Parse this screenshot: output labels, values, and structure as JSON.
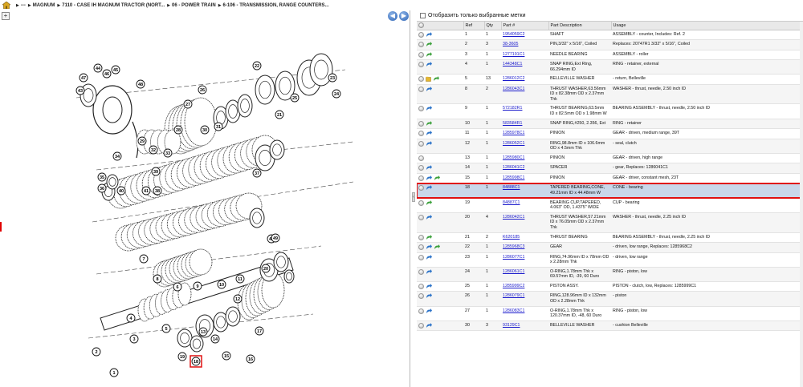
{
  "breadcrumb": {
    "items": [
      "---",
      "MAGNUM",
      "7110 - CASE IH MAGNUM TRACTOR (NORT...",
      "06 - POWER TRAIN",
      "6-106 - TRANSMISSION, RANGE COUNTERS..."
    ]
  },
  "diagram": {
    "zoom_label": "+",
    "prev_label": "◀",
    "next_label": "▶",
    "callouts": [
      "1",
      "2",
      "3",
      "4",
      "5",
      "6",
      "7",
      "8",
      "9",
      "10",
      "11",
      "12",
      "13",
      "14",
      "15",
      "16",
      "17",
      "18",
      "19",
      "20",
      "21",
      "22",
      "23",
      "24",
      "25",
      "26",
      "27",
      "28",
      "29",
      "30",
      "31",
      "32",
      "33",
      "34",
      "35",
      "36",
      "37",
      "38",
      "39",
      "40",
      "41",
      "42",
      "43",
      "44",
      "45",
      "46",
      "47",
      "48",
      "49"
    ],
    "highlighted_callout": "18"
  },
  "filter": {
    "label": "Отобразить только выбранные метки",
    "checked": false
  },
  "table": {
    "columns": [
      "",
      "Ref",
      "Qty",
      "Part #",
      "Part Description",
      "Usage"
    ],
    "rows": [
      {
        "icons": [
          "info",
          "arrow-blue"
        ],
        "ref": "1",
        "qty": "1",
        "part": "1954059C2",
        "desc": "SHAFT",
        "usage": "ASSEMBLY - counter, Includes: Ref. 2"
      },
      {
        "icons": [
          "info",
          "arrow-green"
        ],
        "ref": "2",
        "qty": "3",
        "part": "38-3605",
        "desc": "PIN,3/32\" x 5/16\", Coiled",
        "usage": "Replaces: 20747R1 3/32\" x 5/16\", Coiled"
      },
      {
        "icons": [
          "info",
          "arrow-green"
        ],
        "ref": "3",
        "qty": "1",
        "part": "1277191C1",
        "desc": "NEEDLE BEARING",
        "usage": "ASSEMBLY - roller"
      },
      {
        "icons": [
          "info",
          "arrow-blue"
        ],
        "ref": "4",
        "qty": "1",
        "part": "144348C1",
        "desc": "SNAP RING,Ext Rtng, 66.294mm ID",
        "usage": "RING - retainer, external"
      },
      {
        "icons": [
          "info",
          "cart",
          "arrow-green"
        ],
        "ref": "5",
        "qty": "13",
        "part": "1286012C2",
        "desc": "BELLEVILLE WASHER",
        "usage": "- return, Belleville"
      },
      {
        "icons": [
          "info",
          "arrow-blue"
        ],
        "ref": "8",
        "qty": "2",
        "part": "1286043C1",
        "desc": "THRUST WASHER,63.56mm ID x 82.38mm OD x 2.37mm Thk",
        "usage": "WASHER - thrust, needle, 2.50 inch ID"
      },
      {
        "icons": [
          "info",
          "arrow-blue"
        ],
        "ref": "9",
        "qty": "1",
        "part": "572182R1",
        "desc": "THRUST BEARING,63.5mm ID x 82.5mm OD x 1.98mm W",
        "usage": "BEARING ASSEMBLY - thrust, needle, 2.50 inch ID"
      },
      {
        "icons": [
          "info",
          "arrow-green"
        ],
        "ref": "10",
        "qty": "1",
        "part": "583584R1",
        "desc": "SNAP RING,#250, 2.356, Ext",
        "usage": "RING - retainer"
      },
      {
        "icons": [
          "info",
          "arrow-blue"
        ],
        "ref": "11",
        "qty": "1",
        "part": "1285978C1",
        "desc": "PINION",
        "usage": "GEAR - driven, medium range, 39T"
      },
      {
        "icons": [
          "info",
          "arrow-blue"
        ],
        "ref": "12",
        "qty": "1",
        "part": "1286052C1",
        "desc": "RING,98.8mm ID x 106.6mm OD x 4.5mm Thk",
        "usage": "- seal, clutch"
      },
      {
        "icons": [
          "info"
        ],
        "ref": "13",
        "qty": "1",
        "part": "1285980C1",
        "desc": "PINION",
        "usage": "GEAR - driven, high range"
      },
      {
        "icons": [
          "info",
          "arrow-blue"
        ],
        "ref": "14",
        "qty": "1",
        "part": "1286041C2",
        "desc": "SPACER",
        "usage": "- gear, Replaces: 1286041C1"
      },
      {
        "icons": [
          "info",
          "arrow-blue",
          "arrow-green"
        ],
        "ref": "15",
        "qty": "1",
        "part": "1285998C1",
        "desc": "PINION",
        "usage": "GEAR - driver, constant mesh, 23T"
      },
      {
        "icons": [
          "info",
          "arrow-blue"
        ],
        "ref": "18",
        "qty": "1",
        "part": "84888C1",
        "desc": "TAPERED BEARING,CONE, 49.21mm ID x 44.48mm W",
        "usage": "CONE - bearing",
        "selected": true
      },
      {
        "icons": [
          "info",
          "arrow-green"
        ],
        "ref": "19",
        "qty": "",
        "part": "84887C1",
        "desc": "BEARING CUP,TAPERED, 4.063\" OD, 1.4375\" WIDE",
        "usage": "CUP - bearing"
      },
      {
        "icons": [
          "info",
          "arrow-blue"
        ],
        "ref": "20",
        "qty": "4",
        "part": "1286042C1",
        "desc": "THRUST WASHER,57.21mm ID x 76.05mm OD x 2.37mm Thk",
        "usage": "WASHER - thrust, needle, 2.25 inch ID"
      },
      {
        "icons": [
          "info",
          "arrow-green"
        ],
        "ref": "21",
        "qty": "2",
        "part": "K620185",
        "desc": "THRUST BEARING",
        "usage": "BEARING ASSEMBLY - thrust, needle, 2.25 inch ID"
      },
      {
        "icons": [
          "info",
          "arrow-blue",
          "arrow-green"
        ],
        "ref": "22",
        "qty": "1",
        "part": "1285968C3",
        "desc": "GEAR",
        "usage": "- driven, low range, Replaces: 1285968C2"
      },
      {
        "icons": [
          "info",
          "arrow-blue"
        ],
        "ref": "23",
        "qty": "1",
        "part": "1286077C1",
        "desc": "RING,74.96mm ID x 78mm OD x 2.28mm Thk",
        "usage": "- driven, low range"
      },
      {
        "icons": [
          "info",
          "arrow-blue"
        ],
        "ref": "24",
        "qty": "1",
        "part": "1286061C1",
        "desc": "O-RING,1.78mm Thk x 69.57mm ID, -39, 60 Duro",
        "usage": "RING - piston, low"
      },
      {
        "icons": [
          "info",
          "arrow-blue"
        ],
        "ref": "25",
        "qty": "1",
        "part": "1285999C2",
        "desc": "PISTON ASSY.",
        "usage": "PISTON - clutch, low, Replaces: 1285999C1"
      },
      {
        "icons": [
          "info",
          "arrow-blue"
        ],
        "ref": "26",
        "qty": "1",
        "part": "1286079C1",
        "desc": "RING,128.96mm ID x 132mm OD x 2.28mm Thk",
        "usage": "- piston"
      },
      {
        "icons": [
          "info",
          "arrow-blue"
        ],
        "ref": "27",
        "qty": "1",
        "part": "1286083C1",
        "desc": "O-RING,1.78mm Thk x 120.37mm ID, -48, 60 Duro",
        "usage": "RING - piston, low"
      },
      {
        "icons": [
          "info",
          "arrow-blue"
        ],
        "ref": "30",
        "qty": "3",
        "part": "93129C1",
        "desc": "BELLEVILLE WASHER",
        "usage": "- cushion Belleville"
      }
    ]
  },
  "colors": {
    "link": "#1a1acc",
    "selection_outline": "#e01010",
    "selection_fill": "#c9d7ea",
    "arrow_blue": "#2a72c8",
    "arrow_green": "#3aa03a"
  }
}
